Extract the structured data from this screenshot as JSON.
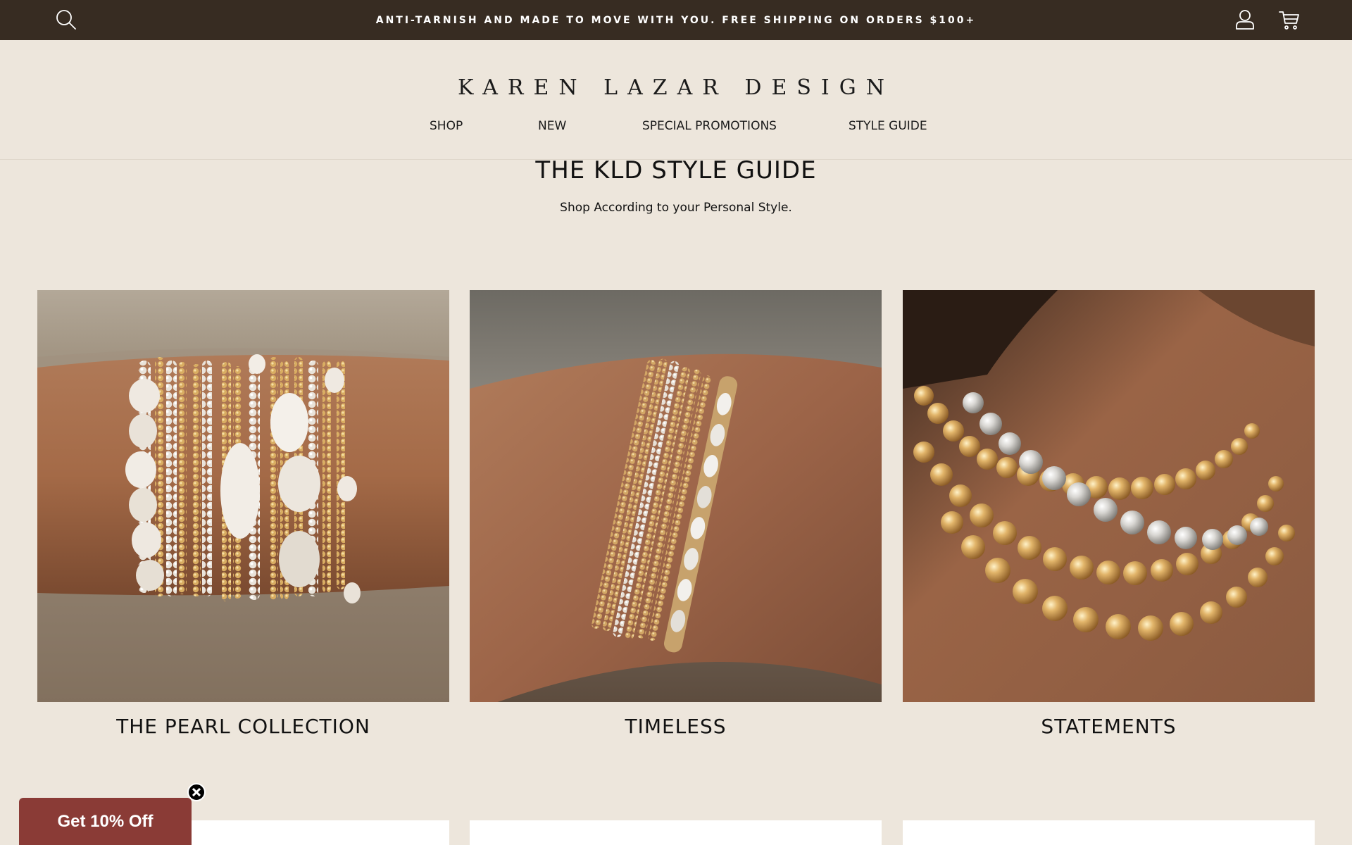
{
  "announcement": {
    "text": "ANTI-TARNISH AND MADE TO MOVE WITH YOU. FREE SHIPPING ON ORDERS $100+"
  },
  "header": {
    "logo": "KAREN LAZAR DESIGN",
    "nav": [
      {
        "label": "SHOP"
      },
      {
        "label": "NEW"
      },
      {
        "label": "SPECIAL PROMOTIONS"
      },
      {
        "label": "STYLE GUIDE"
      }
    ]
  },
  "main": {
    "title": "THE KLD STYLE GUIDE",
    "subtitle": "Shop According to your Personal Style.",
    "collections": [
      {
        "label": "THE PEARL COLLECTION"
      },
      {
        "label": "TIMELESS"
      },
      {
        "label": "STATEMENTS"
      }
    ]
  },
  "promo": {
    "label": "Get 10% Off"
  },
  "icons": [
    "search-icon",
    "account-icon",
    "cart-icon",
    "close-icon"
  ],
  "colors": {
    "announcement_bg": "#372c22",
    "page_bg": "#ede6dc",
    "promo_bg": "#8a3b36"
  }
}
